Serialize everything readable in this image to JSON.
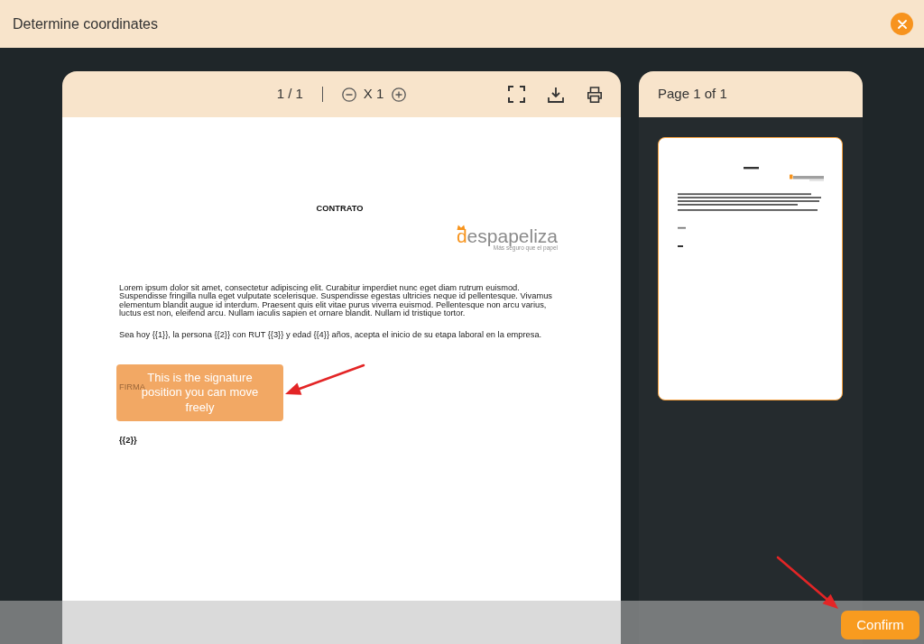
{
  "window": {
    "title": "Determine coordinates"
  },
  "viewer": {
    "toolbar": {
      "page_indicator": "1 / 1",
      "zoom": "X 1"
    },
    "document": {
      "heading": "CONTRATO",
      "logo": {
        "wordmark": "despapeliza",
        "tagline": "Más seguro que el papel"
      },
      "paragraphs": [
        "Lorem ipsum dolor sit amet, consectetur adipiscing elit. Curabitur imperdiet nunc eget diam rutrum euismod. Suspendisse fringilla nulla eget vulputate scelerisque. Suspendisse egestas ultricies neque id pellentesque. Vivamus elementum blandit augue id interdum. Praesent quis elit vitae purus viverra euismod. Pellentesque non arcu varius, luctus est non, eleifend arcu. Nullam iaculis sapien et ornare blandit. Nullam id tristique tortor.",
        "Sea hoy {{1}}, la persona {{2}} con RUT {{3}} y edad {{4}} años, acepta el inicio de su etapa laboral en la empresa."
      ],
      "signature_label": "FIRMA",
      "signer": "{{2}}"
    },
    "signature_marker": {
      "text": "This is the signature position you can move freely"
    }
  },
  "thumbnails": {
    "header": "Page 1 of 1",
    "pages": [
      {
        "selected": true
      }
    ]
  },
  "footer": {
    "confirm_button": "Confirm"
  }
}
